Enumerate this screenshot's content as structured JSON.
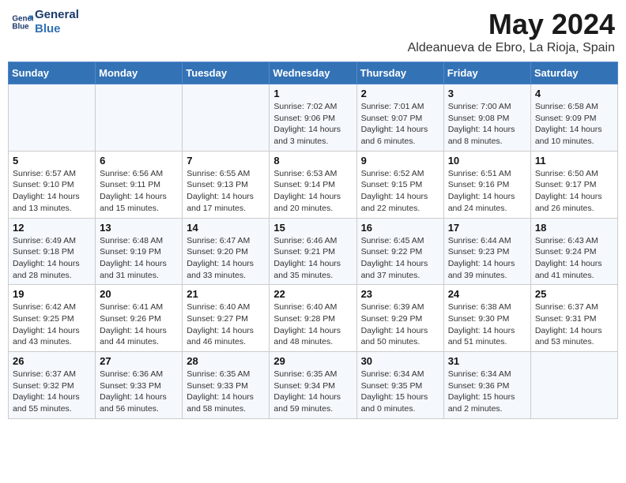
{
  "header": {
    "logo_line1": "General",
    "logo_line2": "Blue",
    "month_year": "May 2024",
    "location": "Aldeanueva de Ebro, La Rioja, Spain"
  },
  "days_of_week": [
    "Sunday",
    "Monday",
    "Tuesday",
    "Wednesday",
    "Thursday",
    "Friday",
    "Saturday"
  ],
  "weeks": [
    [
      {
        "day": "",
        "sunrise": "",
        "sunset": "",
        "daylight": ""
      },
      {
        "day": "",
        "sunrise": "",
        "sunset": "",
        "daylight": ""
      },
      {
        "day": "",
        "sunrise": "",
        "sunset": "",
        "daylight": ""
      },
      {
        "day": "1",
        "sunrise": "Sunrise: 7:02 AM",
        "sunset": "Sunset: 9:06 PM",
        "daylight": "Daylight: 14 hours and 3 minutes."
      },
      {
        "day": "2",
        "sunrise": "Sunrise: 7:01 AM",
        "sunset": "Sunset: 9:07 PM",
        "daylight": "Daylight: 14 hours and 6 minutes."
      },
      {
        "day": "3",
        "sunrise": "Sunrise: 7:00 AM",
        "sunset": "Sunset: 9:08 PM",
        "daylight": "Daylight: 14 hours and 8 minutes."
      },
      {
        "day": "4",
        "sunrise": "Sunrise: 6:58 AM",
        "sunset": "Sunset: 9:09 PM",
        "daylight": "Daylight: 14 hours and 10 minutes."
      }
    ],
    [
      {
        "day": "5",
        "sunrise": "Sunrise: 6:57 AM",
        "sunset": "Sunset: 9:10 PM",
        "daylight": "Daylight: 14 hours and 13 minutes."
      },
      {
        "day": "6",
        "sunrise": "Sunrise: 6:56 AM",
        "sunset": "Sunset: 9:11 PM",
        "daylight": "Daylight: 14 hours and 15 minutes."
      },
      {
        "day": "7",
        "sunrise": "Sunrise: 6:55 AM",
        "sunset": "Sunset: 9:13 PM",
        "daylight": "Daylight: 14 hours and 17 minutes."
      },
      {
        "day": "8",
        "sunrise": "Sunrise: 6:53 AM",
        "sunset": "Sunset: 9:14 PM",
        "daylight": "Daylight: 14 hours and 20 minutes."
      },
      {
        "day": "9",
        "sunrise": "Sunrise: 6:52 AM",
        "sunset": "Sunset: 9:15 PM",
        "daylight": "Daylight: 14 hours and 22 minutes."
      },
      {
        "day": "10",
        "sunrise": "Sunrise: 6:51 AM",
        "sunset": "Sunset: 9:16 PM",
        "daylight": "Daylight: 14 hours and 24 minutes."
      },
      {
        "day": "11",
        "sunrise": "Sunrise: 6:50 AM",
        "sunset": "Sunset: 9:17 PM",
        "daylight": "Daylight: 14 hours and 26 minutes."
      }
    ],
    [
      {
        "day": "12",
        "sunrise": "Sunrise: 6:49 AM",
        "sunset": "Sunset: 9:18 PM",
        "daylight": "Daylight: 14 hours and 28 minutes."
      },
      {
        "day": "13",
        "sunrise": "Sunrise: 6:48 AM",
        "sunset": "Sunset: 9:19 PM",
        "daylight": "Daylight: 14 hours and 31 minutes."
      },
      {
        "day": "14",
        "sunrise": "Sunrise: 6:47 AM",
        "sunset": "Sunset: 9:20 PM",
        "daylight": "Daylight: 14 hours and 33 minutes."
      },
      {
        "day": "15",
        "sunrise": "Sunrise: 6:46 AM",
        "sunset": "Sunset: 9:21 PM",
        "daylight": "Daylight: 14 hours and 35 minutes."
      },
      {
        "day": "16",
        "sunrise": "Sunrise: 6:45 AM",
        "sunset": "Sunset: 9:22 PM",
        "daylight": "Daylight: 14 hours and 37 minutes."
      },
      {
        "day": "17",
        "sunrise": "Sunrise: 6:44 AM",
        "sunset": "Sunset: 9:23 PM",
        "daylight": "Daylight: 14 hours and 39 minutes."
      },
      {
        "day": "18",
        "sunrise": "Sunrise: 6:43 AM",
        "sunset": "Sunset: 9:24 PM",
        "daylight": "Daylight: 14 hours and 41 minutes."
      }
    ],
    [
      {
        "day": "19",
        "sunrise": "Sunrise: 6:42 AM",
        "sunset": "Sunset: 9:25 PM",
        "daylight": "Daylight: 14 hours and 43 minutes."
      },
      {
        "day": "20",
        "sunrise": "Sunrise: 6:41 AM",
        "sunset": "Sunset: 9:26 PM",
        "daylight": "Daylight: 14 hours and 44 minutes."
      },
      {
        "day": "21",
        "sunrise": "Sunrise: 6:40 AM",
        "sunset": "Sunset: 9:27 PM",
        "daylight": "Daylight: 14 hours and 46 minutes."
      },
      {
        "day": "22",
        "sunrise": "Sunrise: 6:40 AM",
        "sunset": "Sunset: 9:28 PM",
        "daylight": "Daylight: 14 hours and 48 minutes."
      },
      {
        "day": "23",
        "sunrise": "Sunrise: 6:39 AM",
        "sunset": "Sunset: 9:29 PM",
        "daylight": "Daylight: 14 hours and 50 minutes."
      },
      {
        "day": "24",
        "sunrise": "Sunrise: 6:38 AM",
        "sunset": "Sunset: 9:30 PM",
        "daylight": "Daylight: 14 hours and 51 minutes."
      },
      {
        "day": "25",
        "sunrise": "Sunrise: 6:37 AM",
        "sunset": "Sunset: 9:31 PM",
        "daylight": "Daylight: 14 hours and 53 minutes."
      }
    ],
    [
      {
        "day": "26",
        "sunrise": "Sunrise: 6:37 AM",
        "sunset": "Sunset: 9:32 PM",
        "daylight": "Daylight: 14 hours and 55 minutes."
      },
      {
        "day": "27",
        "sunrise": "Sunrise: 6:36 AM",
        "sunset": "Sunset: 9:33 PM",
        "daylight": "Daylight: 14 hours and 56 minutes."
      },
      {
        "day": "28",
        "sunrise": "Sunrise: 6:35 AM",
        "sunset": "Sunset: 9:33 PM",
        "daylight": "Daylight: 14 hours and 58 minutes."
      },
      {
        "day": "29",
        "sunrise": "Sunrise: 6:35 AM",
        "sunset": "Sunset: 9:34 PM",
        "daylight": "Daylight: 14 hours and 59 minutes."
      },
      {
        "day": "30",
        "sunrise": "Sunrise: 6:34 AM",
        "sunset": "Sunset: 9:35 PM",
        "daylight": "Daylight: 15 hours and 0 minutes."
      },
      {
        "day": "31",
        "sunrise": "Sunrise: 6:34 AM",
        "sunset": "Sunset: 9:36 PM",
        "daylight": "Daylight: 15 hours and 2 minutes."
      },
      {
        "day": "",
        "sunrise": "",
        "sunset": "",
        "daylight": ""
      }
    ]
  ]
}
